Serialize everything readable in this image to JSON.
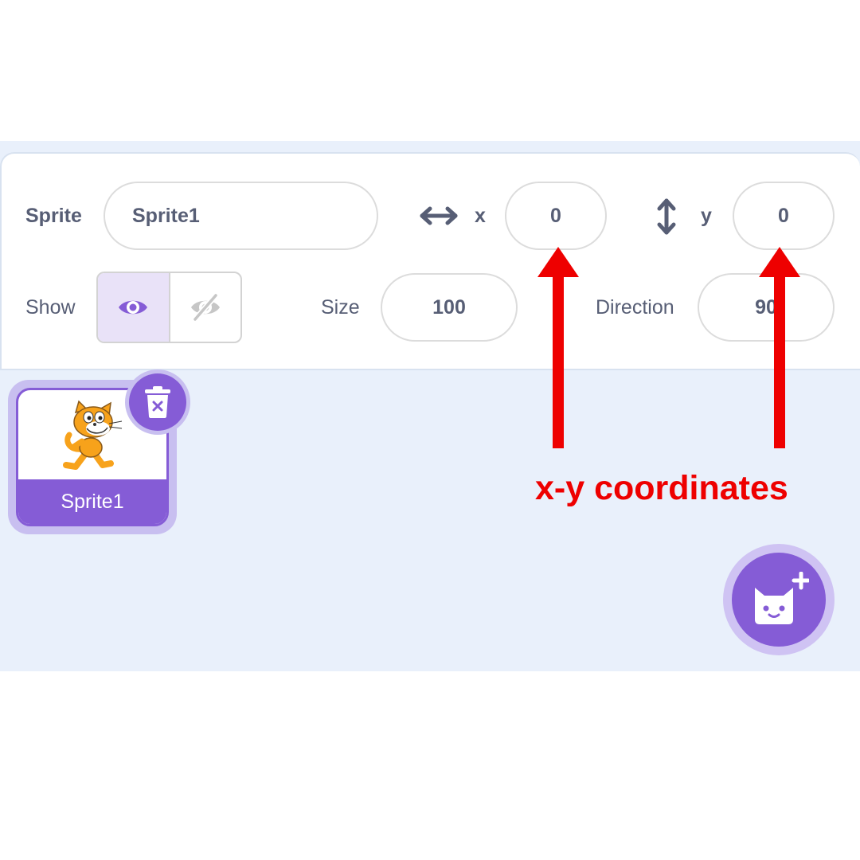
{
  "sprite_info": {
    "sprite_label": "Sprite",
    "sprite_name": "Sprite1",
    "x_label": "x",
    "x_value": "0",
    "y_label": "y",
    "y_value": "0",
    "show_label": "Show",
    "size_label": "Size",
    "size_value": "100",
    "direction_label": "Direction",
    "direction_value": "90"
  },
  "sprites": [
    {
      "name": "Sprite1",
      "selected": true
    }
  ],
  "icons": {
    "x_axis": "horizontal-double-arrow-icon",
    "y_axis": "vertical-double-arrow-icon",
    "show": "eye-icon",
    "hide": "eye-slash-icon",
    "delete": "trash-icon",
    "add_sprite": "add-sprite-cat-icon"
  },
  "annotation": {
    "text": "x-y coordinates",
    "color": "#ee0000"
  },
  "colors": {
    "accent": "#855cd6",
    "pane_background": "#e9f0fb",
    "label_text": "#575e75"
  }
}
